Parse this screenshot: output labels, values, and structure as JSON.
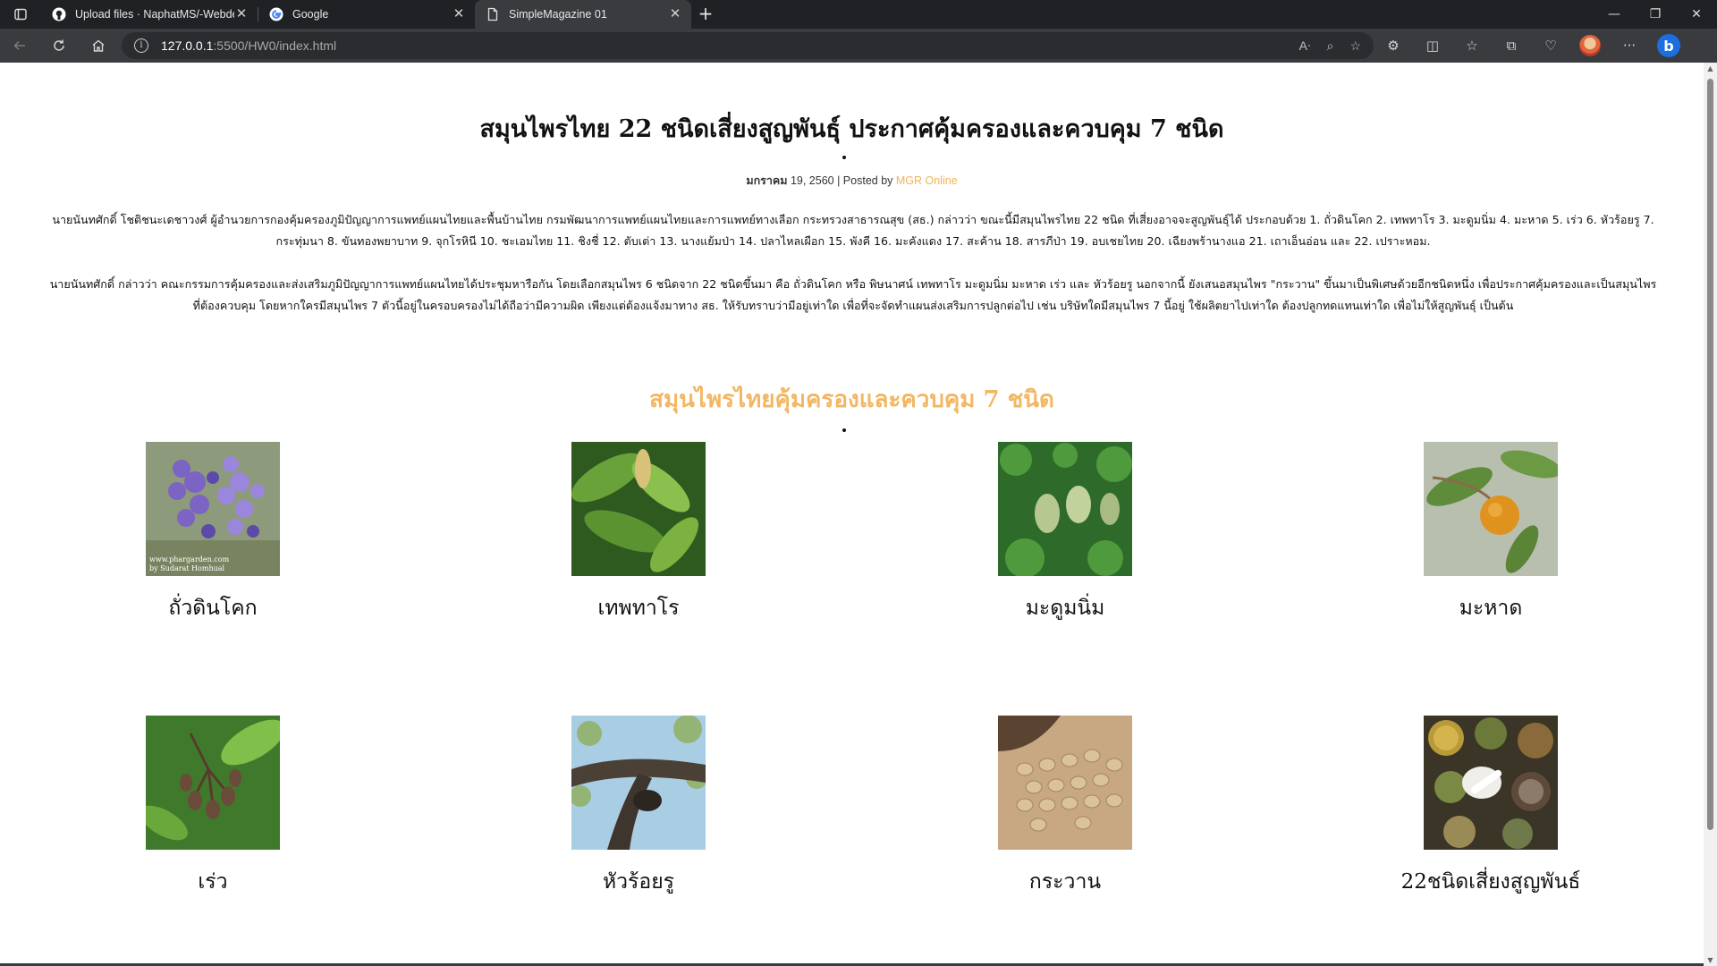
{
  "browser": {
    "tabs": [
      {
        "title": "Upload files · NaphatMS/-Webde",
        "icon": "github-icon",
        "active": false
      },
      {
        "title": "Google",
        "icon": "google-icon",
        "active": false
      },
      {
        "title": "SimpleMagazine 01",
        "icon": "page-icon",
        "active": true
      }
    ],
    "url_host": "127.0.0.1",
    "url_path": ":5500/HW0/index.html"
  },
  "article": {
    "title": "สมุนไพรไทย 22 ชนิดเสี่ยงสูญพันธุ์ ประกาศคุ้มครองและควบคุม 7 ชนิด",
    "date": "มกราคม",
    "date_rest": " 19, 2560 | Posted by ",
    "author": "MGR Online",
    "paragraph1": "นายนันทศักดิ์ โชติชนะเดชาวงศ์ ผู้อำนวยการกองคุ้มครองภูมิปัญญาการแพทย์แผนไทยและพื้นบ้านไทย กรมพัฒนาการแพทย์แผนไทยและการแพทย์ทางเลือก กระทรวงสาธารณสุข (สธ.) กล่าวว่า ขณะนี้มีสมุนไพรไทย 22 ชนิด ที่เสี่ยงอาจจะสูญพันธุ์ได้ ประกอบด้วย 1. ถั่วดินโคก 2. เทพทาโร 3. มะดูมนิ่ม 4. มะหาด 5. เร่ว 6. หัวร้อยรู 7. กระทุ่มนา 8. ขันทองพยาบาท 9. จุกโรหินี 10. ชะเอมไทย 11. ชิงชี่ 12. ตับเต่า 13. นางแย้มป่า 14. ปลาไหลเผือก 15. พังคี 16. มะคังแดง 17. สะค้าน 18. สารภีป่า 19. อบเชยไทย 20. เฉียงพร้านางแอ 21. เถาเอ็นอ่อน และ 22. เปราะหอม.",
    "paragraph2": "นายนันทศักดิ์ กล่าวว่า คณะกรรมการคุ้มครองและส่งเสริมภูมิปัญญาการแพทย์แผนไทยได้ประชุมหารือกัน โดยเลือกสมุนไพร 6 ชนิดจาก 22 ชนิดขึ้นมา คือ ถั่วดินโคก หรือ พิษนาศน์ เทพทาโร มะดูมนิ่ม มะหาด เร่ว และ หัวร้อยรู นอกจากนี้ ยังเสนอสมุนไพร \"กระวาน\" ขึ้นมาเป็นพิเศษด้วยอีกชนิดหนึ่ง เพื่อประกาศคุ้มครองและเป็นสมุนไพรที่ต้องควบคุม โดยหากใครมีสมุนไพร 7 ตัวนี้อยู่ในครอบครองไม่ได้ถือว่ามีความผิด เพียงแต่ต้องแจ้งมาทาง สธ. ให้รับทราบว่ามีอยู่เท่าใด เพื่อที่จะจัดทำแผนส่งเสริมการปลูกต่อไป เช่น บริษัทใดมีสมุนไพร 7 นี้อยู่ ใช้ผลิตยาไปเท่าใด ต้องปลูกทดแทนเท่าใด เพื่อไม่ให้สูญพันธุ์ เป็นต้น"
  },
  "section": {
    "title": "สมุนไพรไทยคุ้มครองและควบคุม 7 ชนิด"
  },
  "herbs": [
    {
      "name": "ถั่วดินโคก",
      "image": "purple-flower-photo",
      "watermark1": "www.phargarden.com",
      "watermark2": "by Sudarat Homhual"
    },
    {
      "name": "เทพทาโร",
      "image": "green-leaves-photo"
    },
    {
      "name": "มะดูมนิ่ม",
      "image": "green-fruit-photo"
    },
    {
      "name": "มะหาด",
      "image": "orange-fruit-photo"
    },
    {
      "name": "เร่ว",
      "image": "seed-pods-photo"
    },
    {
      "name": "หัวร้อยรู",
      "image": "tree-branch-photo"
    },
    {
      "name": "กระวาน",
      "image": "cardamom-pods-photo"
    },
    {
      "name": "22ชนิดเสี่ยงสูญพันธ์",
      "image": "herb-bowls-photo"
    }
  ]
}
